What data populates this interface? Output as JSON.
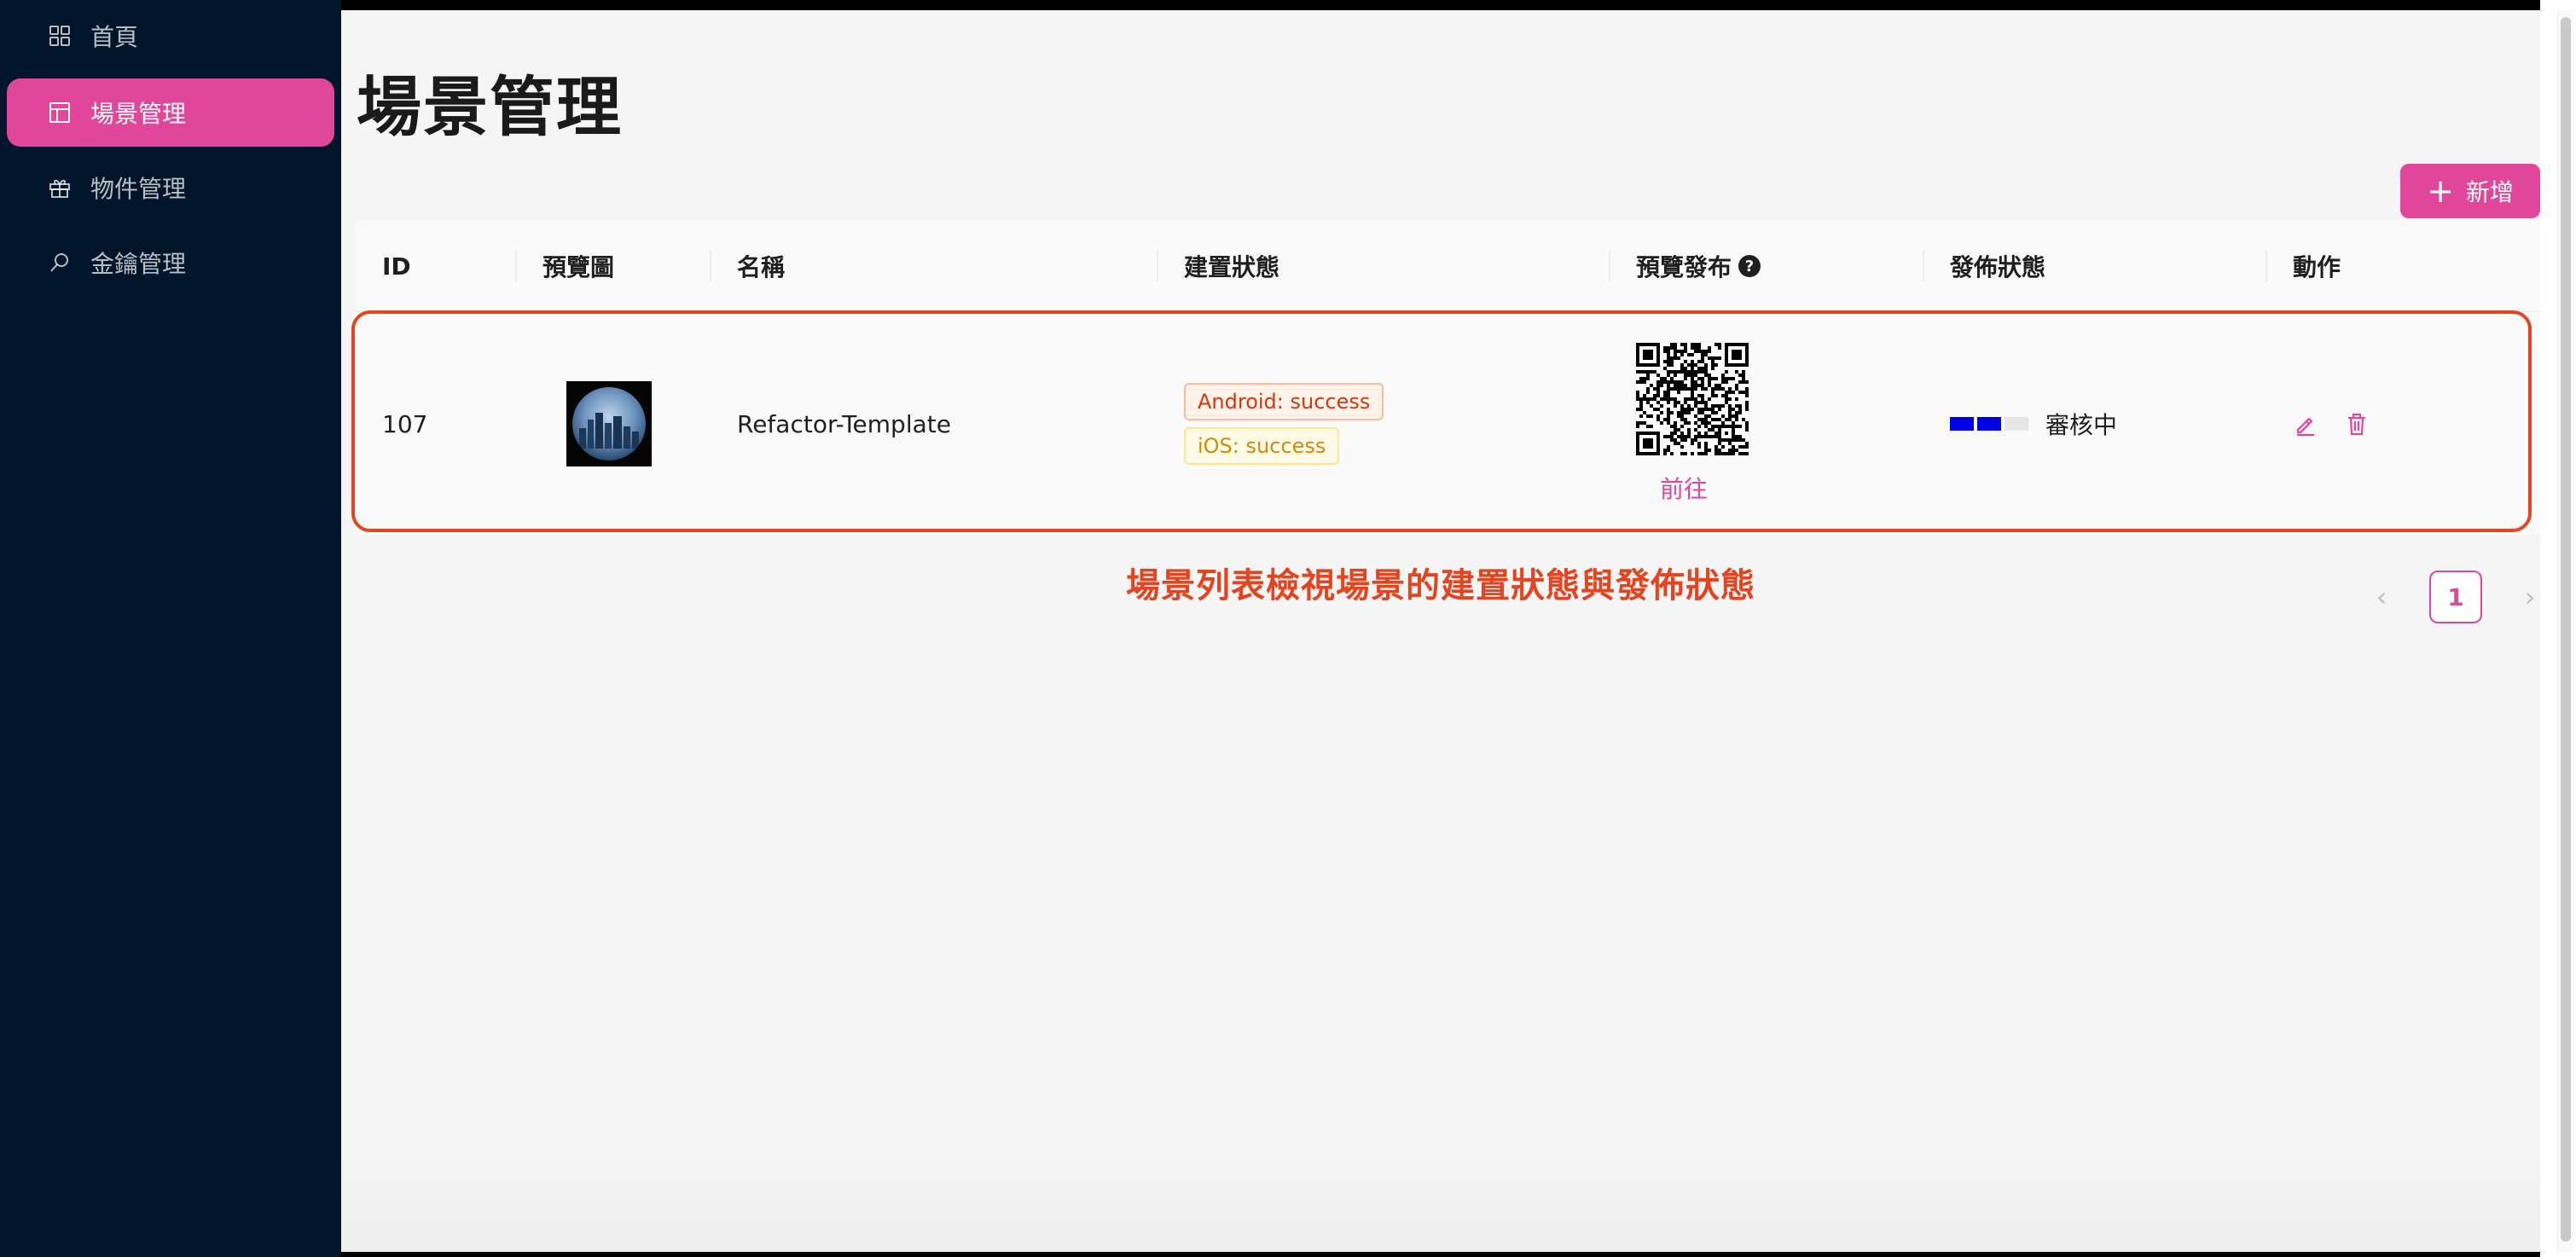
{
  "sidebar": {
    "items": [
      {
        "label": "首頁",
        "icon": "grid-icon",
        "active": false
      },
      {
        "label": "場景管理",
        "icon": "layout-icon",
        "active": true
      },
      {
        "label": "物件管理",
        "icon": "gift-icon",
        "active": false
      },
      {
        "label": "金鑰管理",
        "icon": "key-search-icon",
        "active": false
      }
    ]
  },
  "page": {
    "title": "場景管理",
    "add_label": "新增"
  },
  "table": {
    "columns": [
      "ID",
      "預覽圖",
      "名稱",
      "建置狀態",
      "預覽發布",
      "發佈狀態",
      "動作"
    ],
    "rows": [
      {
        "id": "107",
        "name": "Refactor-Template",
        "build_android": "Android: success",
        "build_ios": "iOS: success",
        "preview_link": "前往",
        "publish_status": "審核中",
        "publish_progress": {
          "done": 2,
          "total": 3
        }
      }
    ]
  },
  "annotation": "場景列表檢視場景的建置狀態與發佈狀態",
  "pagination": {
    "current": "1",
    "prev_icon": "chevron-left-icon",
    "next_icon": "chevron-right-icon"
  },
  "colors": {
    "accent": "#e0479a",
    "sidebar": "#001529",
    "highlight": "#e2451f",
    "progress": "#0000e6"
  }
}
